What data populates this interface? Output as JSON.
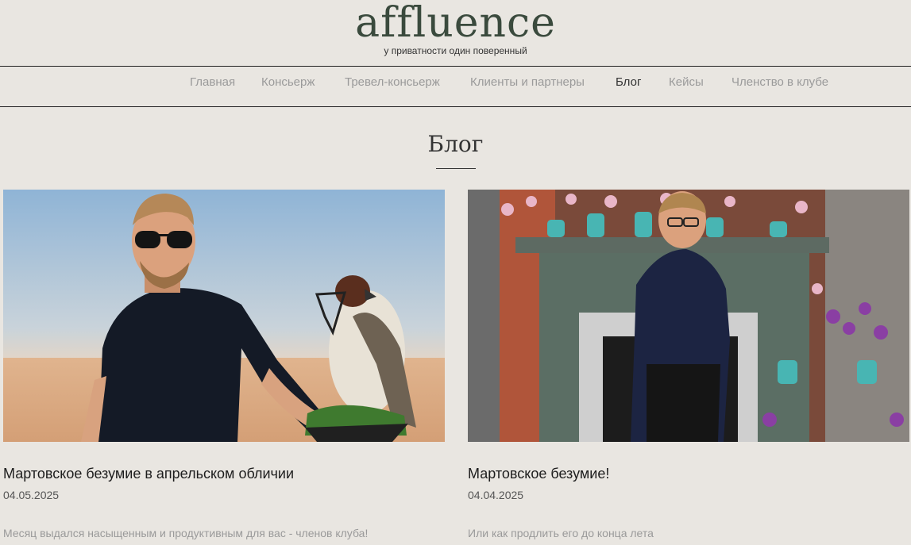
{
  "header": {
    "logo": "affluence",
    "tagline": "у приватности один поверенный"
  },
  "nav": {
    "items": [
      {
        "label": "Главная"
      },
      {
        "label": "Консьерж"
      },
      {
        "label": "Тревел-консьерж"
      },
      {
        "label": "Клиенты и партнеры"
      },
      {
        "label": "Блог",
        "active": true
      },
      {
        "label": "Кейсы"
      },
      {
        "label": "Членство в клубе"
      }
    ]
  },
  "page": {
    "title": "Блог"
  },
  "posts": [
    {
      "title": "Мартовское безумие в апрельском обличии",
      "date": "04.05.2025",
      "excerpt": "Месяц выдался насыщенным и продуктивным для вас - членов клуба!"
    },
    {
      "title": "Мартовское безумие!",
      "date": "04.04.2025",
      "excerpt": "Или как продлить его до конца лета"
    }
  ],
  "colors": {
    "background": "#e9e6e1",
    "logo": "#3a4a3d",
    "nav_inactive": "#9a9a9a",
    "nav_active": "#333333"
  }
}
